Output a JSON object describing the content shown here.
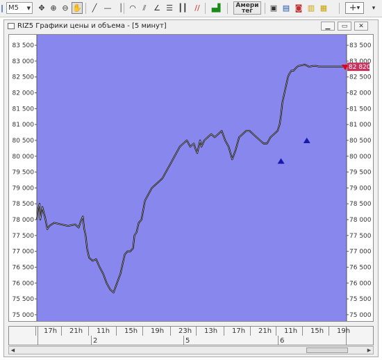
{
  "toolbar": {
    "timeframe": "M5",
    "amer_line1": "Амери",
    "amer_line2": "тег"
  },
  "window": {
    "title": "RIZ5 Графики цены и объема - [5 минут]"
  },
  "colors": {
    "plot_bg": "#8787ee",
    "price_line": "#0a0a0a",
    "highlight": "#ffffff",
    "buy_marker": "#1a1aa8",
    "sell_marker": "#e0001a",
    "current_price_label_bg": "#c7325e"
  },
  "chart_data": {
    "type": "line",
    "title": "",
    "ylim": [
      74800,
      83700
    ],
    "y_ticks": [
      "83 500",
      "83 000",
      "82 500",
      "82 000",
      "81 500",
      "81 000",
      "80 500",
      "80 000",
      "79 500",
      "79 000",
      "78 500",
      "78 000",
      "77 500",
      "77 000",
      "76 500",
      "76 000",
      "75 500",
      "75 000"
    ],
    "x_tick_labels": [
      "17h",
      "21h",
      "11h",
      "15h",
      "19h",
      "23h",
      "13h",
      "17h",
      "21h",
      "11h",
      "15h",
      "19h"
    ],
    "day_labels": [
      "2",
      "5",
      "6"
    ],
    "current_price": "82 820",
    "series": [
      {
        "x": [
          0,
          2,
          4,
          5,
          8,
          12,
          15,
          18,
          25,
          35,
          45,
          55,
          60,
          63,
          66,
          68,
          70,
          72,
          75,
          80,
          85,
          90,
          95,
          100,
          105,
          110,
          115,
          120,
          126,
          130,
          134,
          138,
          140,
          143,
          146,
          150,
          155,
          160,
          165,
          170,
          175,
          180,
          185,
          190,
          195,
          200,
          205,
          210,
          215,
          220,
          225,
          228,
          230,
          232,
          234,
          236,
          238,
          240,
          245,
          250,
          255,
          260,
          265,
          270,
          275,
          280,
          285,
          290,
          295,
          300,
          305,
          310,
          315,
          320,
          325,
          330,
          335,
          340,
          345,
          348,
          350,
          352,
          354,
          356,
          358,
          360,
          362,
          365,
          368,
          370,
          372,
          375,
          378,
          380,
          382,
          384,
          386,
          388,
          390,
          392,
          394,
          396,
          398,
          400,
          402,
          404,
          406,
          408,
          410,
          412,
          414,
          416,
          418,
          420,
          422,
          424,
          426,
          428,
          430,
          432,
          434,
          436,
          438,
          440,
          442,
          444
        ],
        "values": [
          78000,
          78350,
          78500,
          78000,
          78400,
          78050,
          77700,
          77800,
          77900,
          77850,
          77800,
          77850,
          77750,
          77950,
          78100,
          77700,
          77500,
          77100,
          76800,
          76700,
          76750,
          76500,
          76300,
          76000,
          75800,
          75700,
          76000,
          76300,
          76900,
          77000,
          77000,
          77100,
          77500,
          77600,
          77900,
          78000,
          78600,
          78800,
          79000,
          79100,
          79200,
          79300,
          79500,
          79700,
          79900,
          80100,
          80300,
          80400,
          80500,
          80300,
          80400,
          80200,
          80100,
          80300,
          80500,
          80300,
          80400,
          80500,
          80600,
          80700,
          80600,
          80700,
          80800,
          80500,
          80300,
          79900,
          80200,
          80600,
          80700,
          80800,
          80800,
          80700,
          80600,
          80500,
          80400,
          80400,
          80600,
          80700,
          80800,
          81000,
          81300,
          81700,
          81900,
          82100,
          82300,
          82500,
          82600,
          82700,
          82700,
          82750,
          82800,
          82850,
          82860,
          82870,
          82880,
          82890,
          82870,
          82850,
          82820,
          82830,
          82840,
          82850,
          82850,
          82850,
          82840,
          82830,
          82830,
          82830,
          82830,
          82830,
          82830,
          82830,
          82830,
          82830,
          82830,
          82830,
          82830,
          82830,
          82830,
          82830,
          82830,
          82830,
          82830,
          82830,
          82830,
          82830
        ]
      }
    ],
    "markers": [
      {
        "type": "buy",
        "x": 350,
        "y": 79850
      },
      {
        "type": "buy",
        "x": 387,
        "y": 80500
      },
      {
        "type": "sell",
        "x": 442,
        "y": 82800
      }
    ]
  }
}
